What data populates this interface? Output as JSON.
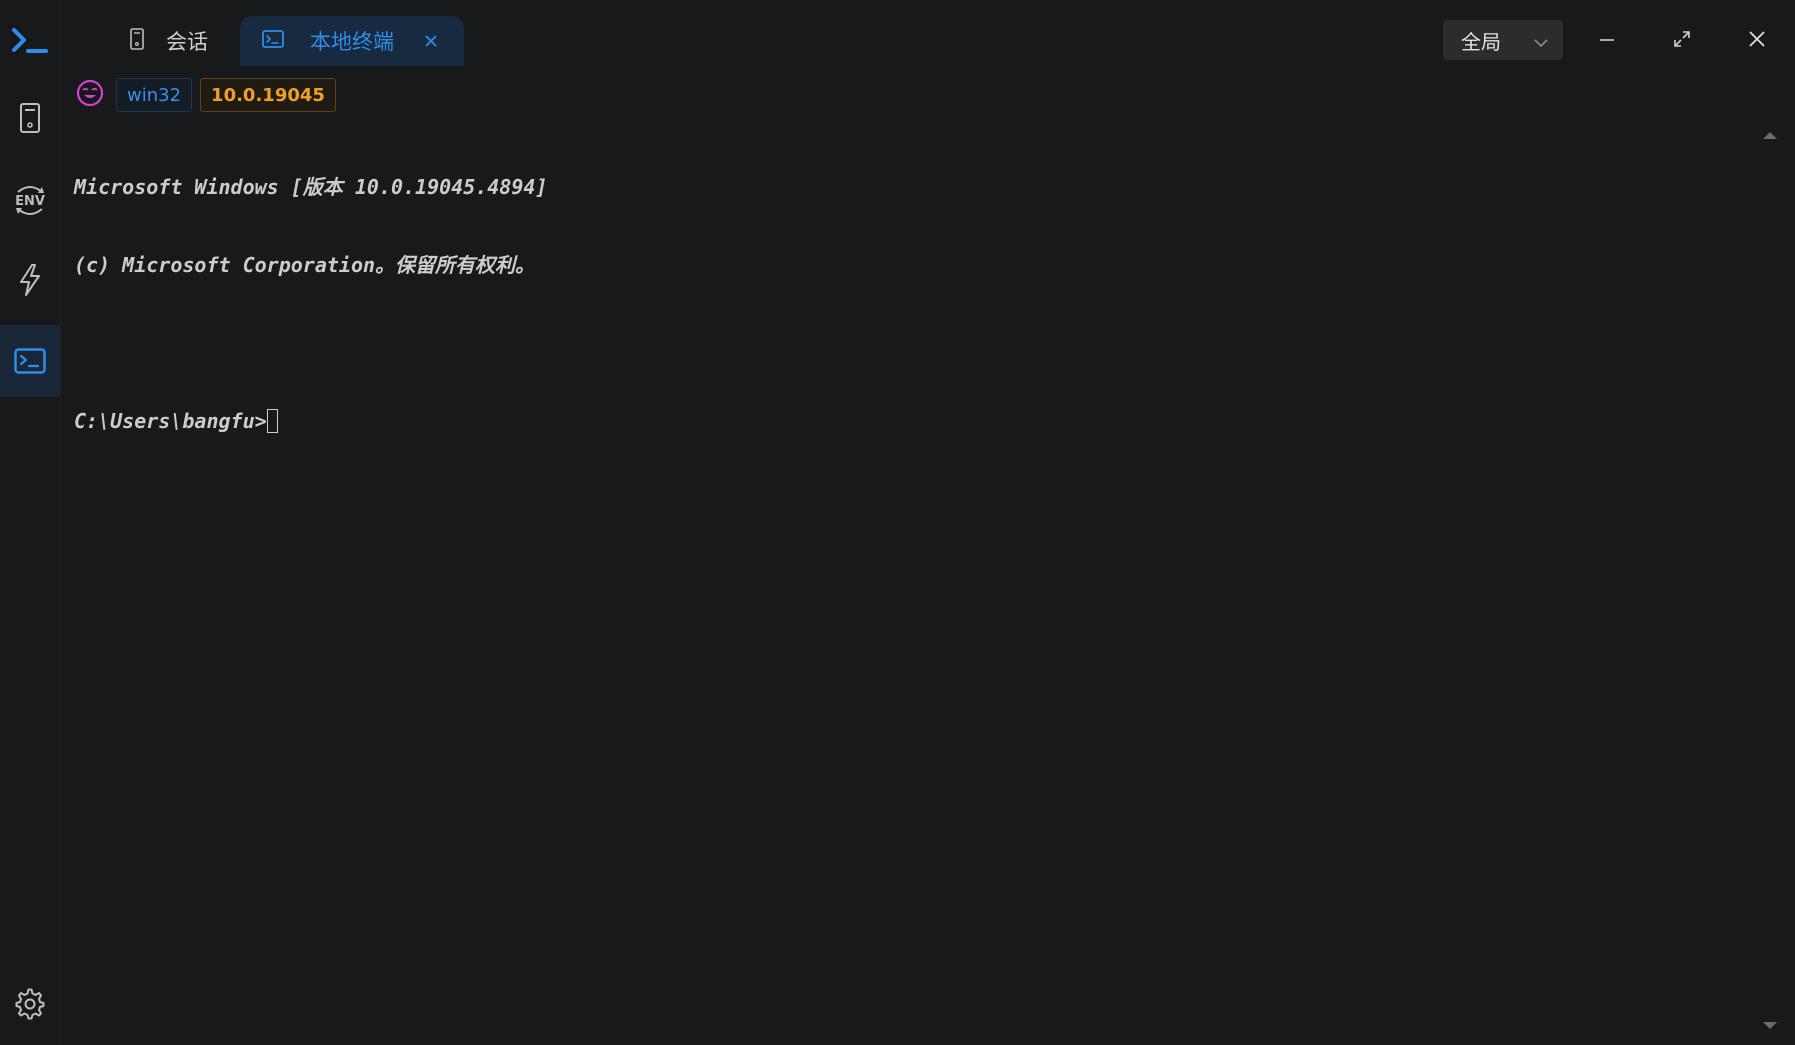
{
  "app": {
    "title": "Terminal"
  },
  "sidebar": {
    "items": [
      {
        "name": "sessions",
        "icon": "server-icon"
      },
      {
        "name": "env",
        "icon": "env-icon"
      },
      {
        "name": "quick-commands",
        "icon": "lightning-icon"
      },
      {
        "name": "local-terminal",
        "icon": "terminal-icon",
        "active": true
      }
    ],
    "settings_icon": "gear-icon"
  },
  "tabs": [
    {
      "label": "会话",
      "icon": "server-icon",
      "active": false
    },
    {
      "label": "本地终端",
      "icon": "terminal-icon",
      "active": true,
      "closable": true
    }
  ],
  "scope_select": {
    "value": "全局"
  },
  "window_controls": [
    "minimize",
    "maximize",
    "close"
  ],
  "badges": {
    "platform": "win32",
    "version": "10.0.19045"
  },
  "terminal": {
    "lines": [
      "Microsoft Windows [版本 10.0.19045.4894]",
      "(c) Microsoft Corporation。保留所有权利。",
      ""
    ],
    "prompt": "C:\\Users\\bangfu>"
  },
  "colors": {
    "background": "#18191a",
    "accent": "#2e8de8",
    "active_tab_bg": "#172a40",
    "version_badge": "#f0a020",
    "emoji": "#d63ed6"
  }
}
